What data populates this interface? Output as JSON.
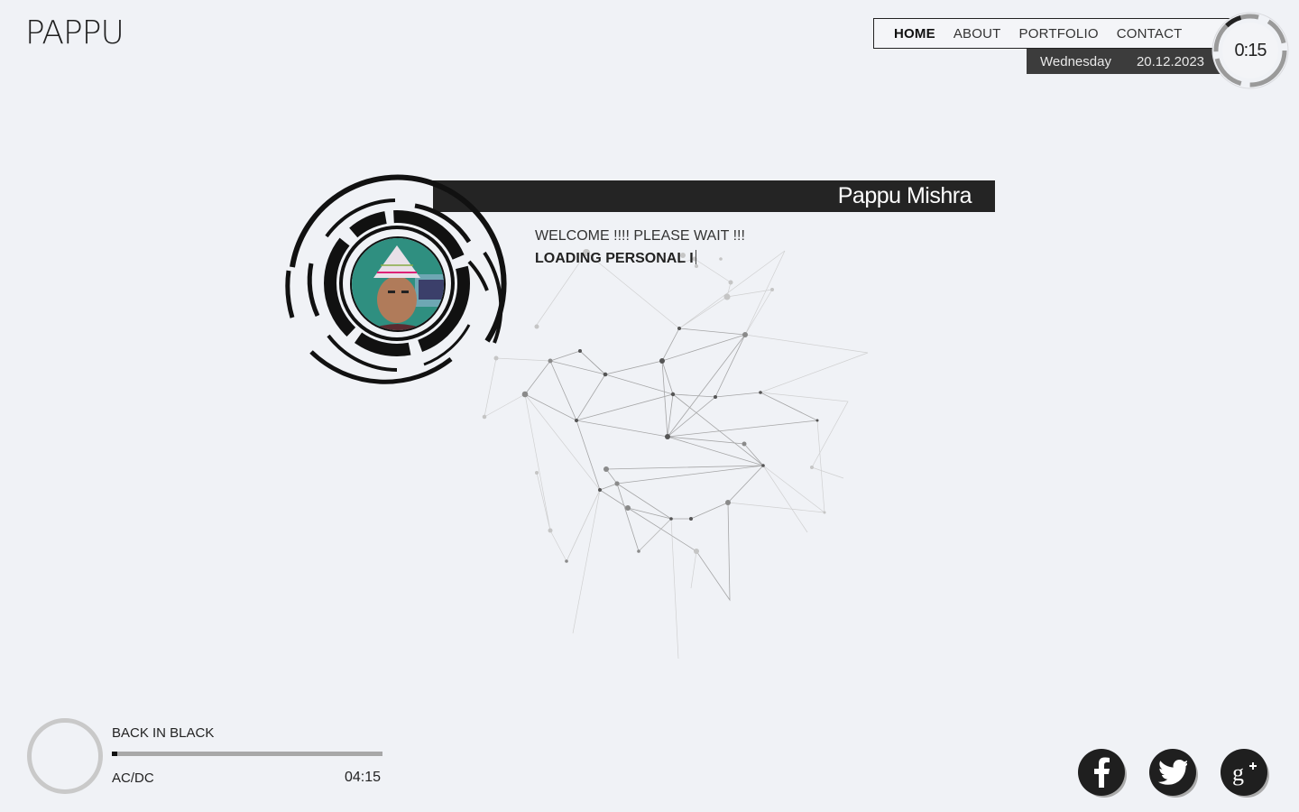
{
  "header": {
    "logo": "PAPPU"
  },
  "nav": {
    "items": [
      {
        "label": "HOME",
        "active": true
      },
      {
        "label": "ABOUT",
        "active": false
      },
      {
        "label": "PORTFOLIO",
        "active": false
      },
      {
        "label": "CONTACT",
        "active": false
      }
    ]
  },
  "date": {
    "day": "Wednesday",
    "date": "20.12.2023"
  },
  "clock": {
    "time": "0:15"
  },
  "profile": {
    "name": "Pappu Mishra",
    "welcome": "WELCOME !!!! PLEASE WAIT !!!",
    "loading": "LOADING PERSONAL I"
  },
  "player": {
    "title": "BACK IN BLACK",
    "artist": "AC/DC",
    "duration": "04:15",
    "progress": 0.02
  },
  "social": {
    "items": [
      {
        "name": "facebook-icon"
      },
      {
        "name": "twitter-icon"
      },
      {
        "name": "google-plus-icon"
      }
    ]
  },
  "colors": {
    "background": "#f0f2f6",
    "dark": "#242424",
    "date_bar": "#3c3c3c",
    "track": "#a8a8a8"
  }
}
